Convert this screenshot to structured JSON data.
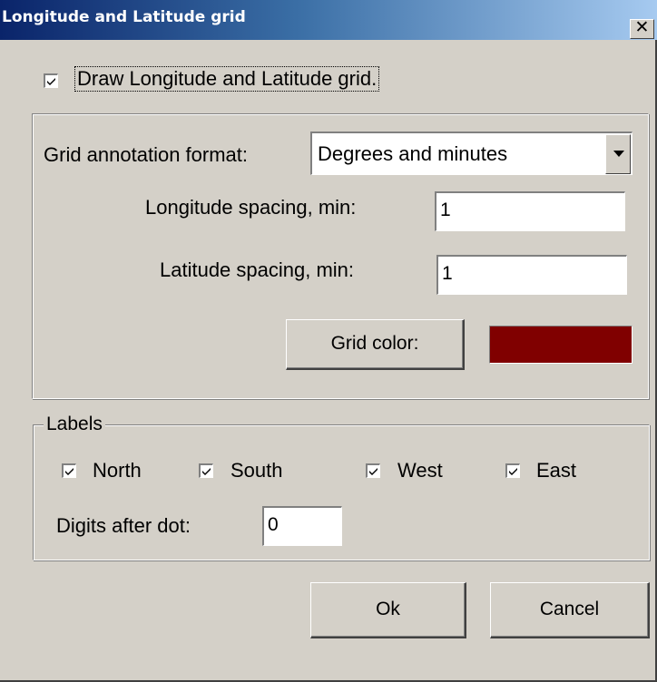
{
  "window": {
    "title": "Longitude and Latitude grid",
    "close_glyph": "✕"
  },
  "grid_toggle": {
    "label": "Draw Longitude and Latitude grid.",
    "checked": true
  },
  "grid_settings": {
    "format_label": "Grid annotation format:",
    "format_value": "Degrees and minutes",
    "longitude_label": "Longitude spacing, min:",
    "longitude_value": "1",
    "latitude_label": "Latitude spacing, min:",
    "latitude_value": "1",
    "color_button_label": "Grid color:",
    "grid_color": "#800000"
  },
  "labels_group": {
    "title": "Labels",
    "north_label": "North",
    "south_label": "South",
    "west_label": "West",
    "east_label": "East",
    "north_checked": true,
    "south_checked": true,
    "west_checked": true,
    "east_checked": true,
    "digits_label": "Digits after dot:",
    "digits_value": "0"
  },
  "buttons": {
    "ok_label": "Ok",
    "cancel_label": "Cancel"
  },
  "icons": {
    "checkmark": "checkmark-icon",
    "dropdown_arrow": "chevron-down-icon",
    "close": "close-icon"
  }
}
